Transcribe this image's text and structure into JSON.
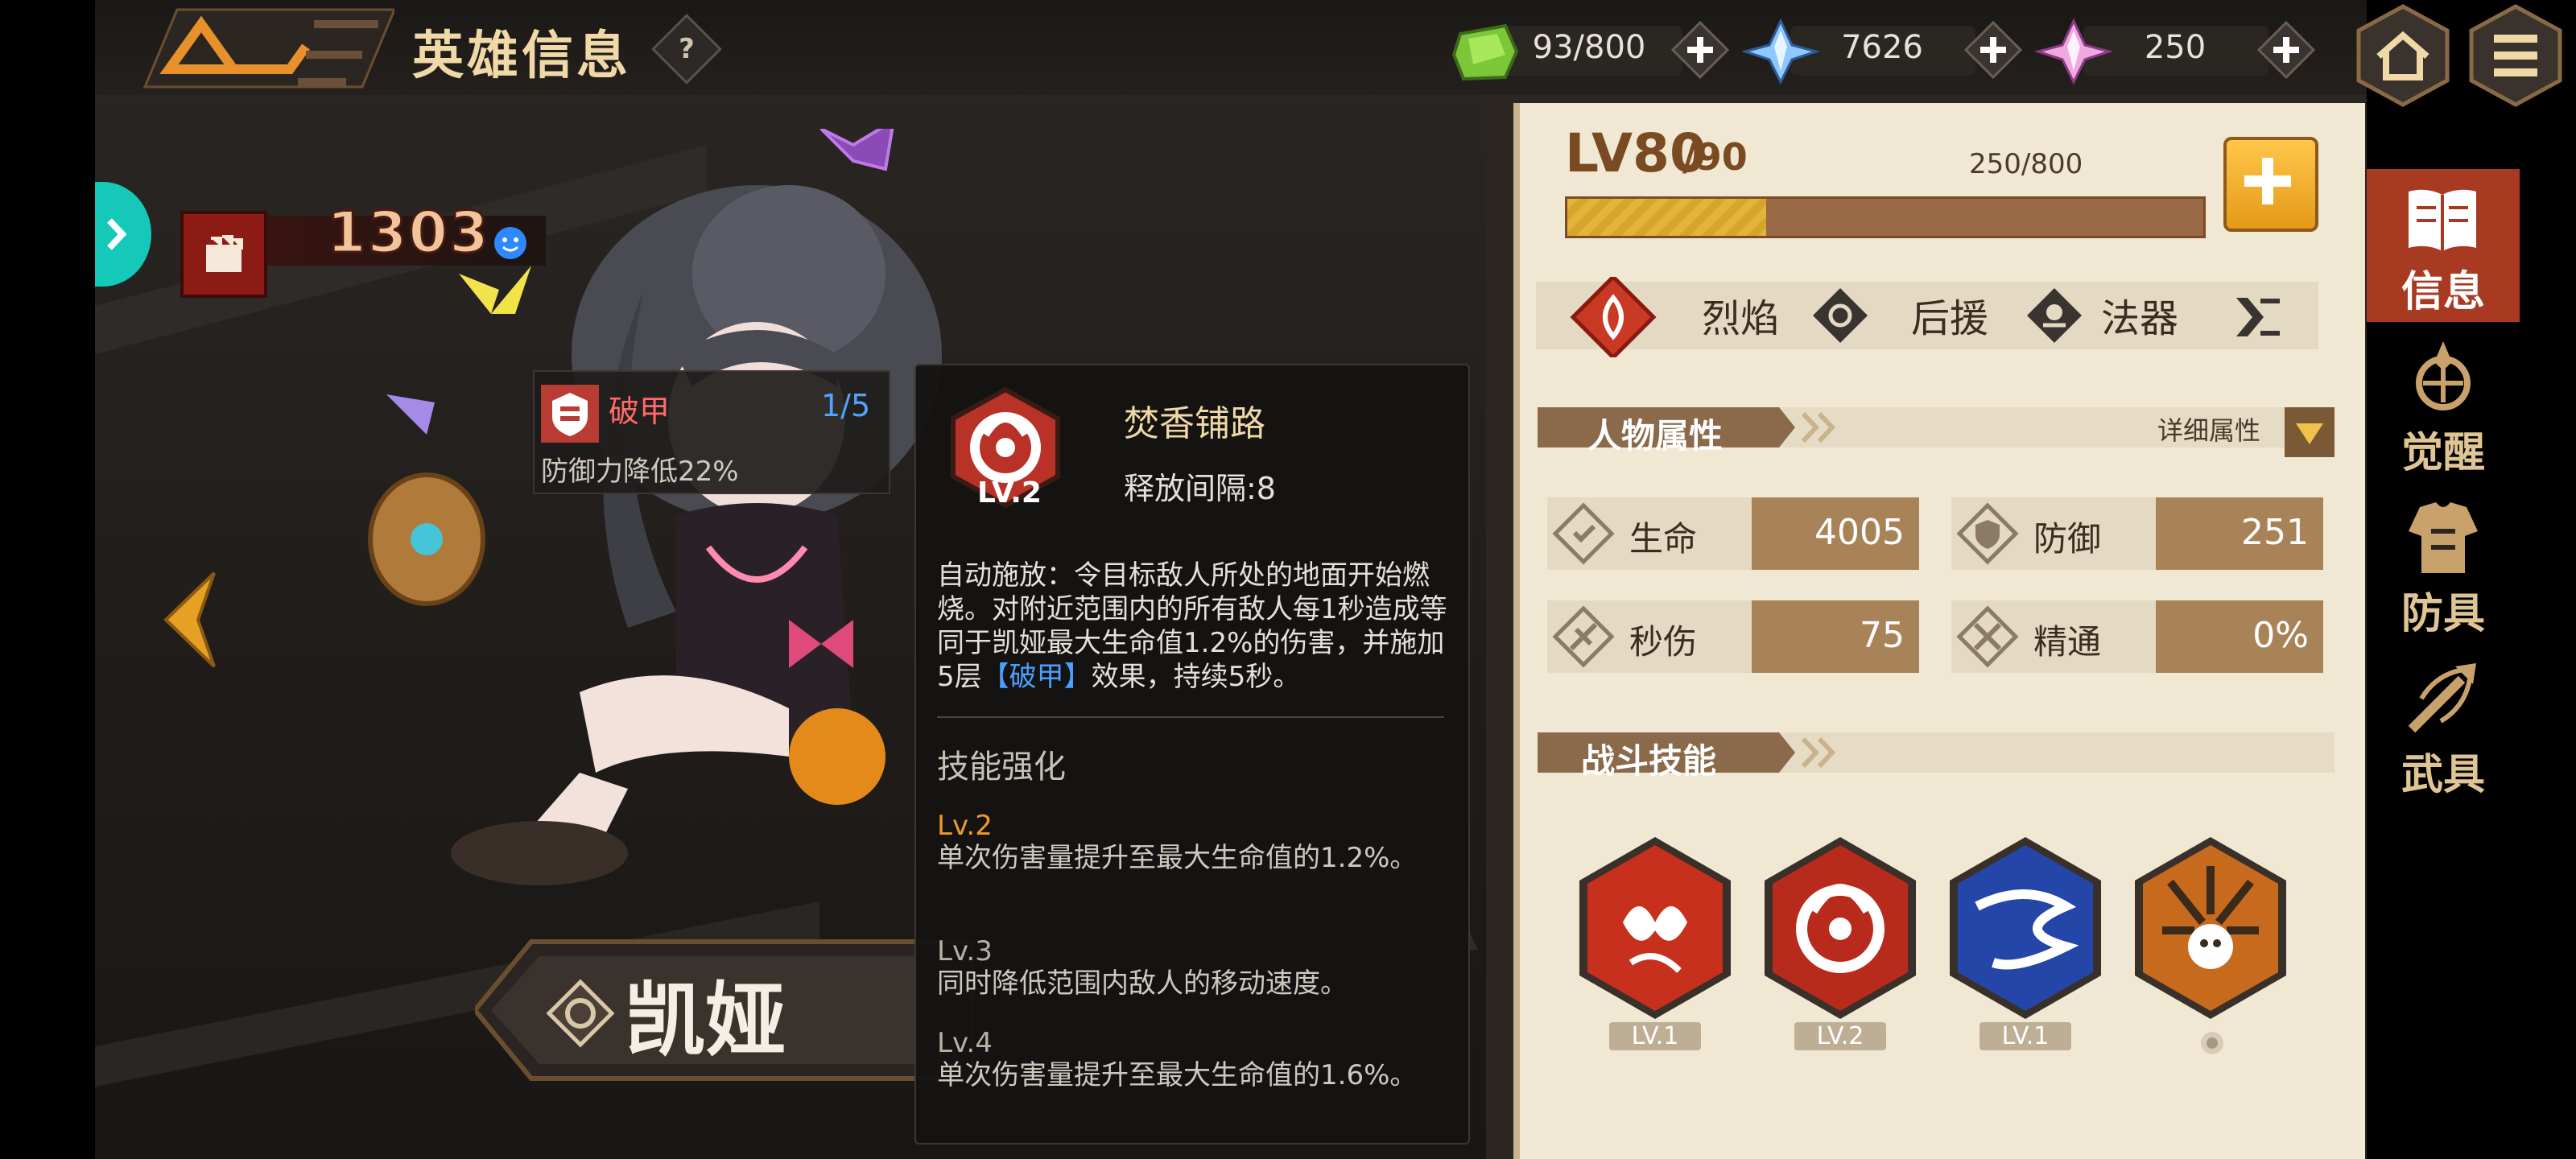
{
  "header": {
    "title": "英雄信息",
    "help_icon": "?",
    "resources": [
      {
        "name": "stamina",
        "icon": "green-gem-icon",
        "value": "93/800"
      },
      {
        "name": "crystal",
        "icon": "blue-crystal-icon",
        "value": "7626"
      },
      {
        "name": "diamond",
        "icon": "pink-crystal-icon",
        "value": "250"
      }
    ],
    "plus_label": "+"
  },
  "hero": {
    "power": "1303",
    "name": "凯娅"
  },
  "buff": {
    "name": "破甲",
    "stack": "1/5",
    "desc": "防御力降低22%"
  },
  "skill_tip": {
    "icon_level": "LV.2",
    "name": "焚香铺路",
    "interval": "释放间隔:8",
    "desc_part1": "自动施放：令目标敌人所处的地面开始燃烧。对附近范围内的所有敌人每1秒造成等同于凯娅最大生命值1.2%的伤害，并施加5层",
    "desc_keyword": "【破甲】",
    "desc_part2": "效果，持续5秒。",
    "enhance_title": "技能强化",
    "enhancements": [
      {
        "lv": "Lv.2",
        "desc": "单次伤害量提升至最大生命值的1.2%。"
      },
      {
        "lv": "Lv.3",
        "desc": "同时降低范围内敌人的移动速度。"
      },
      {
        "lv": "Lv.4",
        "desc": "单次伤害量提升至最大生命值的1.6%。"
      }
    ]
  },
  "panel": {
    "level_main": "LV80",
    "level_sub": "/90",
    "exp_text": "250/800",
    "exp_progress": 0.3125,
    "tags": [
      "烈焰",
      "后援",
      "法器"
    ],
    "attr_section": "人物属性",
    "detail_label": "详细属性",
    "attributes": [
      {
        "label": "生命",
        "value": "4005"
      },
      {
        "label": "防御",
        "value": "251"
      },
      {
        "label": "秒伤",
        "value": "75"
      },
      {
        "label": "精通",
        "value": "0%"
      }
    ],
    "skills_section": "战斗技能",
    "skills": [
      {
        "icon": "butterfly-skill-icon",
        "level": "LV.1"
      },
      {
        "icon": "incense-skill-icon",
        "level": "LV.2"
      },
      {
        "icon": "smoke-wave-skill-icon",
        "level": "LV.1"
      },
      {
        "icon": "spirit-burst-skill-icon",
        "level": ""
      }
    ]
  },
  "side_nav": [
    {
      "label": "信息",
      "icon": "book-icon",
      "active": true
    },
    {
      "label": "觉醒",
      "icon": "awaken-icon",
      "active": false
    },
    {
      "label": "防具",
      "icon": "armor-icon",
      "active": false
    },
    {
      "label": "武具",
      "icon": "weapon-icon",
      "active": false
    }
  ],
  "colors": {
    "accent_gold": "#f0d9a6",
    "panel_bg": "#f1e8d4",
    "attr_value_bg": "#a98358",
    "keyword_blue": "#4aa0ff",
    "buff_red": "#ff6a6a"
  }
}
